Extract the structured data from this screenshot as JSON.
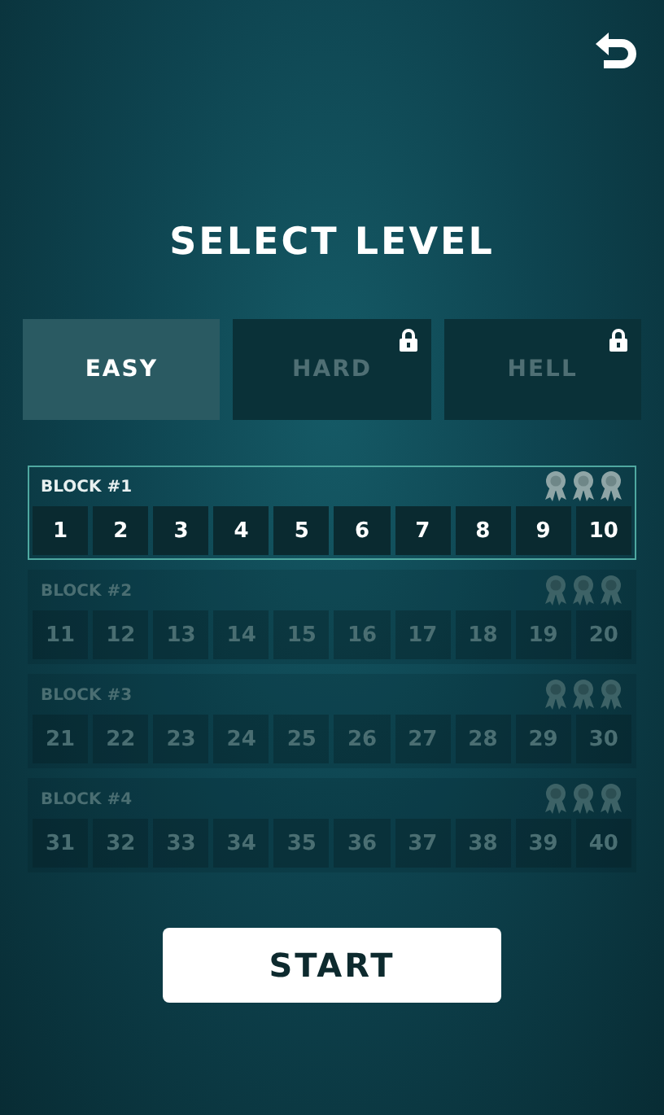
{
  "title": "SELECT LEVEL",
  "tabs": [
    {
      "label": "EASY",
      "selected": true,
      "locked": false
    },
    {
      "label": "HARD",
      "selected": false,
      "locked": true
    },
    {
      "label": "HELL",
      "selected": false,
      "locked": true
    }
  ],
  "blocks": [
    {
      "label": "BLOCK #1",
      "selected": true,
      "levels": [
        "1",
        "2",
        "3",
        "4",
        "5",
        "6",
        "7",
        "8",
        "9",
        "10"
      ]
    },
    {
      "label": "BLOCK #2",
      "selected": false,
      "levels": [
        "11",
        "12",
        "13",
        "14",
        "15",
        "16",
        "17",
        "18",
        "19",
        "20"
      ]
    },
    {
      "label": "BLOCK #3",
      "selected": false,
      "levels": [
        "21",
        "22",
        "23",
        "24",
        "25",
        "26",
        "27",
        "28",
        "29",
        "30"
      ]
    },
    {
      "label": "BLOCK #4",
      "selected": false,
      "levels": [
        "31",
        "32",
        "33",
        "34",
        "35",
        "36",
        "37",
        "38",
        "39",
        "40"
      ]
    }
  ],
  "start_button": "START"
}
